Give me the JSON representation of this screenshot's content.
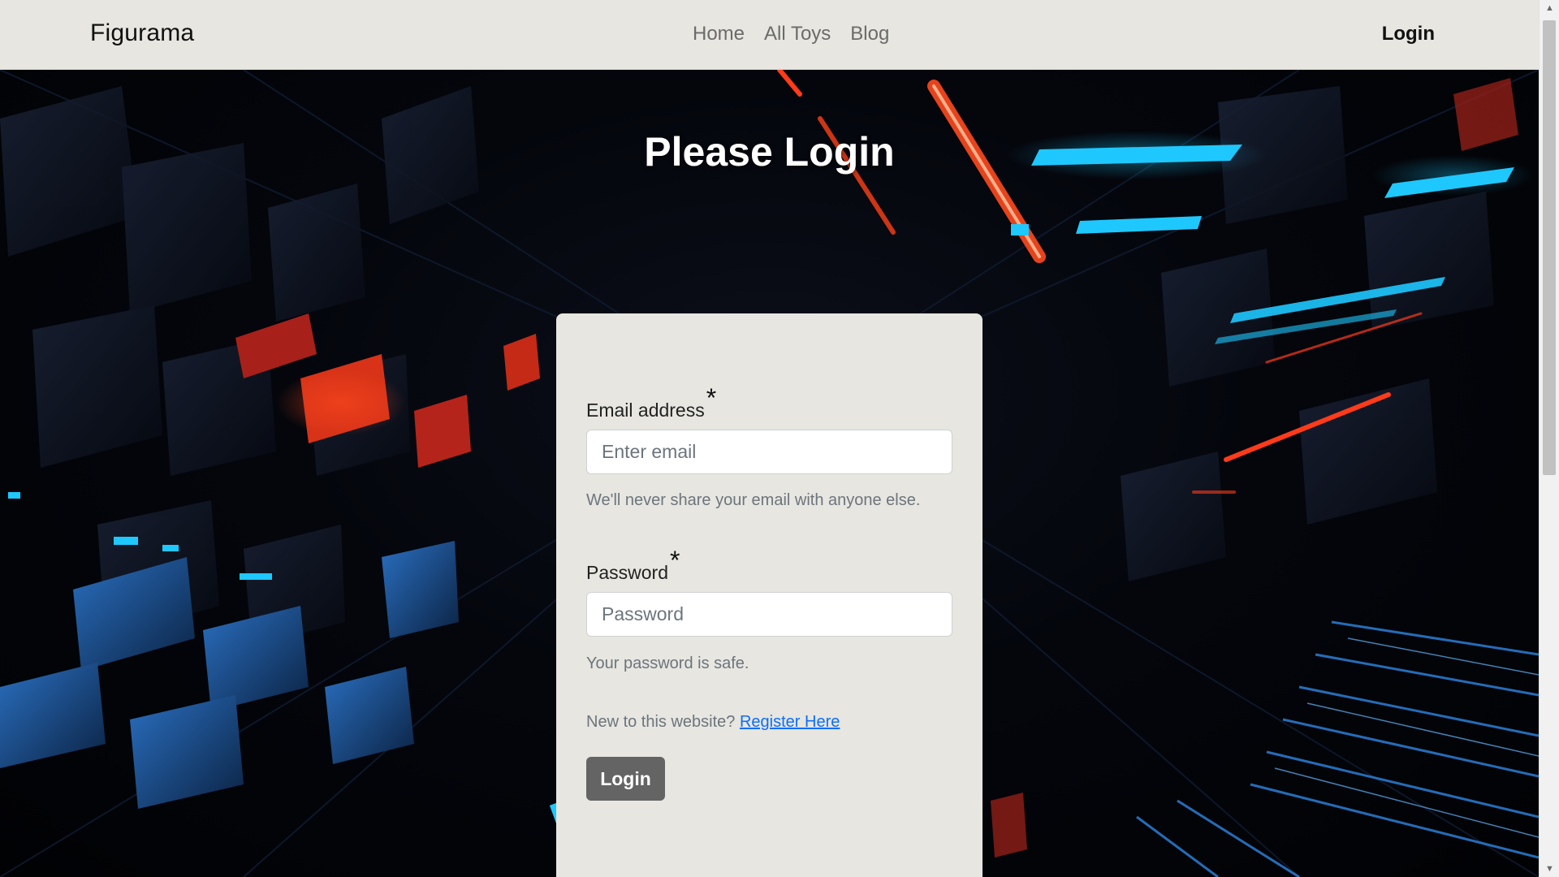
{
  "navbar": {
    "brand": "Figurama",
    "links": [
      {
        "label": "Home"
      },
      {
        "label": "All Toys"
      },
      {
        "label": "Blog"
      }
    ],
    "login": "Login"
  },
  "page": {
    "title": "Please Login"
  },
  "form": {
    "email": {
      "label": "Email address",
      "required_mark": "*",
      "placeholder": "Enter email",
      "help": "We'll never share your email with anyone else."
    },
    "password": {
      "label": "Password",
      "required_mark": "*",
      "placeholder": "Password",
      "help": "Your password is safe."
    },
    "register": {
      "prompt": "New to this website?",
      "link": "Register Here"
    },
    "submit": "Login"
  },
  "colors": {
    "navbar_bg": "#e7e6e0",
    "card_bg": "#e7e6e0",
    "button_bg": "#646464",
    "link": "#0d6efd",
    "neon_blue": "#1ec8ff",
    "neon_red": "#ff3b1a"
  }
}
